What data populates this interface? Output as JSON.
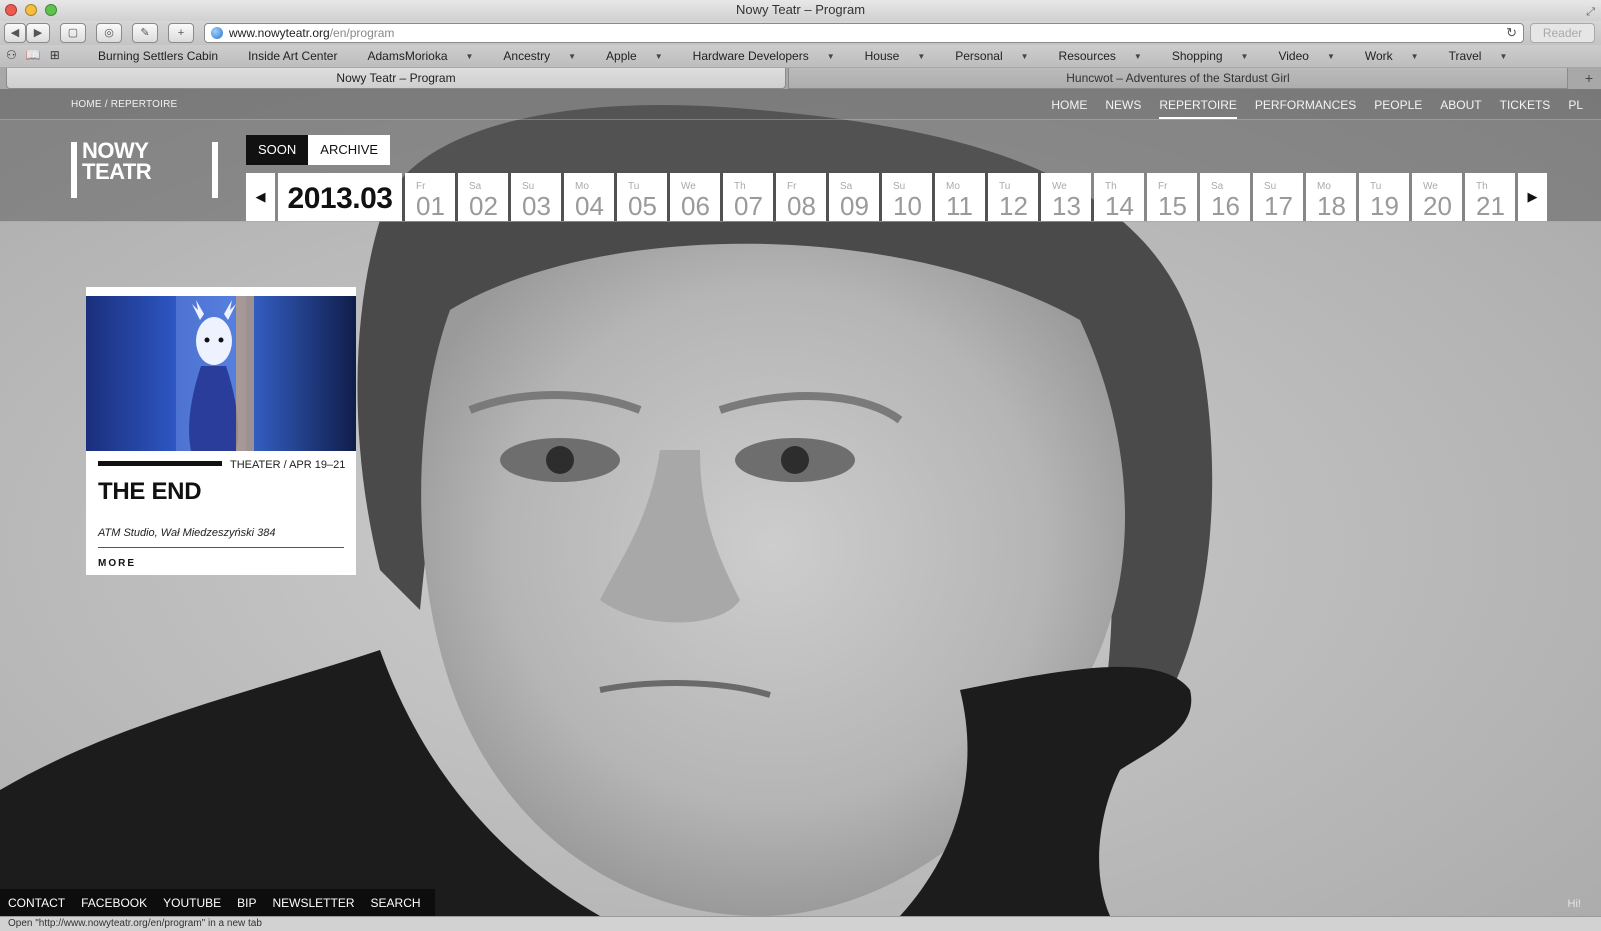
{
  "window": {
    "title": "Nowy Teatr – Program"
  },
  "toolbar": {
    "url_domain": "www.nowyteatr.org",
    "url_path": "/en/program",
    "reader_label": "Reader"
  },
  "bookmarks": [
    {
      "label": "Burning Settlers Cabin",
      "dropdown": false
    },
    {
      "label": "Inside Art Center",
      "dropdown": false
    },
    {
      "label": "AdamsMorioka",
      "dropdown": true
    },
    {
      "label": "Ancestry",
      "dropdown": true
    },
    {
      "label": "Apple",
      "dropdown": true
    },
    {
      "label": "Hardware Developers",
      "dropdown": true
    },
    {
      "label": "House",
      "dropdown": true
    },
    {
      "label": "Personal",
      "dropdown": true
    },
    {
      "label": "Resources",
      "dropdown": true
    },
    {
      "label": "Shopping",
      "dropdown": true
    },
    {
      "label": "Video",
      "dropdown": true
    },
    {
      "label": "Work",
      "dropdown": true
    },
    {
      "label": "Travel",
      "dropdown": true
    }
  ],
  "tabs": [
    {
      "label": "Nowy Teatr – Program",
      "active": true
    },
    {
      "label": "Huncwot – Adventures of the Stardust Girl",
      "active": false
    }
  ],
  "site": {
    "breadcrumb": "HOME / REPERTOIRE",
    "nav": [
      "HOME",
      "NEWS",
      "REPERTOIRE",
      "PERFORMANCES",
      "PEOPLE",
      "ABOUT",
      "TICKETS",
      "PL"
    ],
    "nav_active": "REPERTOIRE",
    "logo_line1": "NOWY",
    "logo_line2": "TEATR",
    "filter_tabs": [
      {
        "label": "SOON",
        "active": true
      },
      {
        "label": "ARCHIVE",
        "active": false
      }
    ],
    "calendar": {
      "month": "2013.03",
      "days": [
        {
          "dow": "Fr",
          "num": "01"
        },
        {
          "dow": "Sa",
          "num": "02"
        },
        {
          "dow": "Su",
          "num": "03"
        },
        {
          "dow": "Mo",
          "num": "04"
        },
        {
          "dow": "Tu",
          "num": "05"
        },
        {
          "dow": "We",
          "num": "06"
        },
        {
          "dow": "Th",
          "num": "07"
        },
        {
          "dow": "Fr",
          "num": "08"
        },
        {
          "dow": "Sa",
          "num": "09"
        },
        {
          "dow": "Su",
          "num": "10"
        },
        {
          "dow": "Mo",
          "num": "11"
        },
        {
          "dow": "Tu",
          "num": "12"
        },
        {
          "dow": "We",
          "num": "13"
        },
        {
          "dow": "Th",
          "num": "14"
        },
        {
          "dow": "Fr",
          "num": "15"
        },
        {
          "dow": "Sa",
          "num": "16"
        },
        {
          "dow": "Su",
          "num": "17"
        },
        {
          "dow": "Mo",
          "num": "18"
        },
        {
          "dow": "Tu",
          "num": "19"
        },
        {
          "dow": "We",
          "num": "20"
        },
        {
          "dow": "Th",
          "num": "21"
        }
      ]
    },
    "event": {
      "category": "THEATER / APR 19–21",
      "title": "THE END",
      "venue": "ATM Studio, Wał Miedzeszyński 384",
      "more": "MORE"
    },
    "footer": [
      "CONTACT",
      "FACEBOOK",
      "YOUTUBE",
      "BIP",
      "NEWSLETTER",
      "SEARCH"
    ],
    "hi": "Hi!"
  },
  "status": "Open \"http://www.nowyteatr.org/en/program\" in a new tab"
}
